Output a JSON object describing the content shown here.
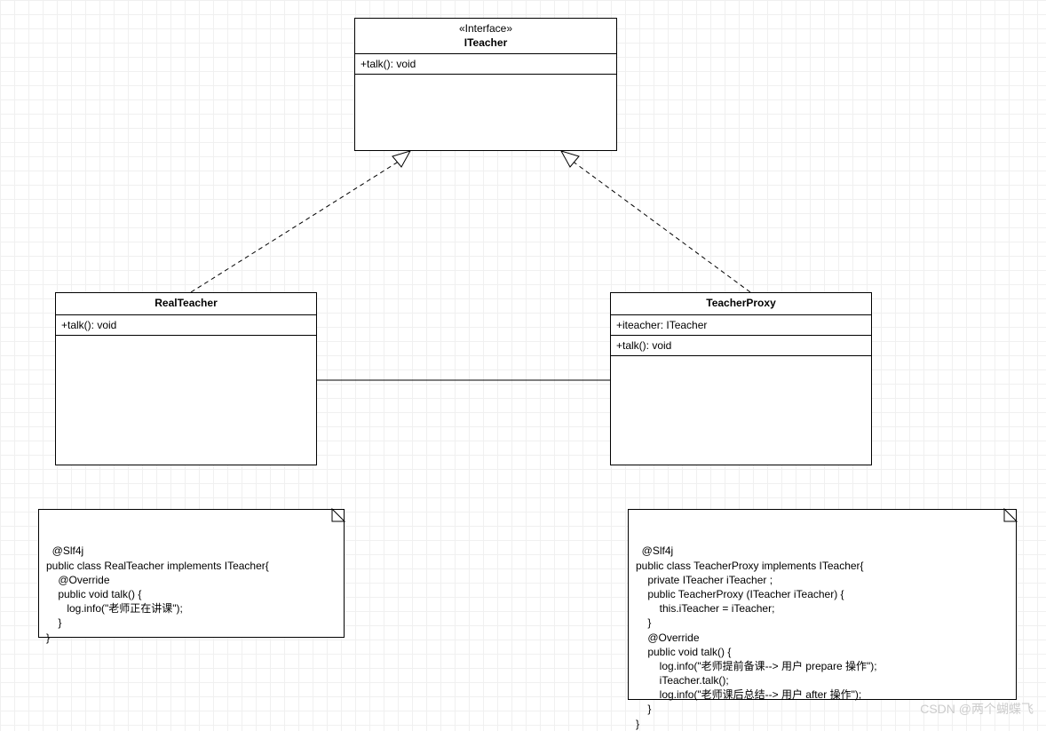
{
  "interface": {
    "stereotype": "«Interface»",
    "name": "ITeacher",
    "methods": [
      "+talk(): void"
    ]
  },
  "realTeacher": {
    "name": "RealTeacher",
    "methods": [
      "+talk(): void"
    ]
  },
  "teacherProxy": {
    "name": "TeacherProxy",
    "attributes": [
      "+iteacher: ITeacher"
    ],
    "methods": [
      "+talk(): void"
    ]
  },
  "note1": {
    "code": "@Slf4j\npublic class RealTeacher implements ITeacher{\n    @Override\n    public void talk() {\n       log.info(\"老师正在讲课\");\n    }\n}"
  },
  "note2": {
    "code": "@Slf4j\npublic class TeacherProxy implements ITeacher{\n    private ITeacher iTeacher ;\n    public TeacherProxy (ITeacher iTeacher) {\n        this.iTeacher = iTeacher;\n    }\n    @Override\n    public void talk() {\n        log.info(\"老师提前备课--> 用户 prepare 操作\");\n        iTeacher.talk();\n        log.info(\"老师课后总结--> 用户 after 操作\");\n    }\n}"
  },
  "watermark": "CSDN @两个蝴蝶飞"
}
